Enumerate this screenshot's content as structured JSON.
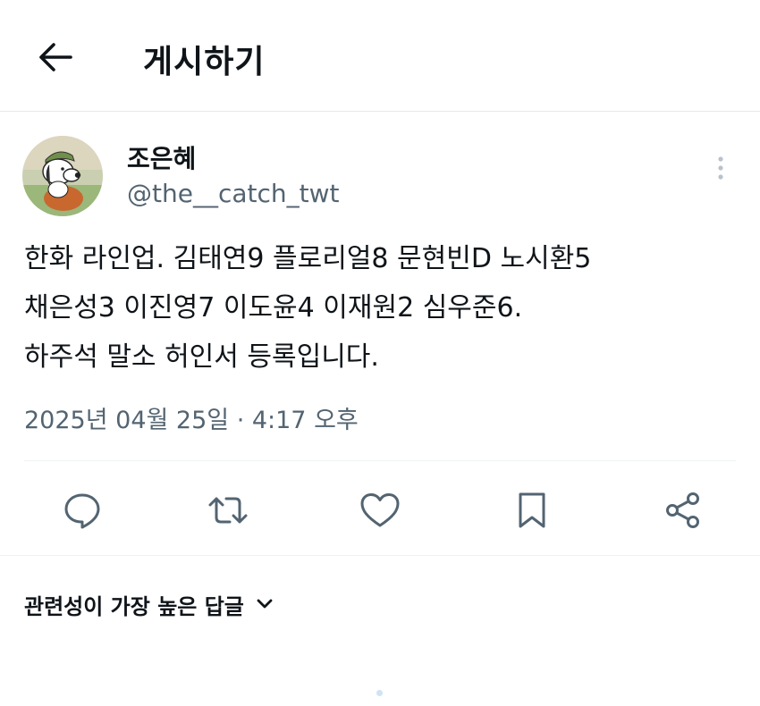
{
  "header": {
    "title": "게시하기",
    "back_icon": "arrow-left-icon"
  },
  "post": {
    "author": {
      "display_name": "조은혜",
      "handle": "@the__catch_twt",
      "avatar_icon": "snoopy-avatar"
    },
    "text_lines": [
      "한화 라인업. 김태연9 플로리얼8 문현빈D 노시환5",
      "채은성3 이진영7 이도윤4 이재원2 심우준6.",
      "하주석 말소 허인서 등록입니다."
    ],
    "timestamp": "2025년 04월 25일 · 4:17 오후"
  },
  "actions": [
    {
      "name": "reply",
      "icon": "speech-bubble-icon"
    },
    {
      "name": "repost",
      "icon": "repost-arrows-icon"
    },
    {
      "name": "like",
      "icon": "heart-icon"
    },
    {
      "name": "bookmark",
      "icon": "bookmark-icon"
    },
    {
      "name": "share",
      "icon": "share-nodes-icon"
    }
  ],
  "replies": {
    "sort_label": "관련성이 가장 높은 답글"
  },
  "colors": {
    "text_primary": "#0f1419",
    "text_secondary": "#536471",
    "divider": "#eff3f4"
  }
}
